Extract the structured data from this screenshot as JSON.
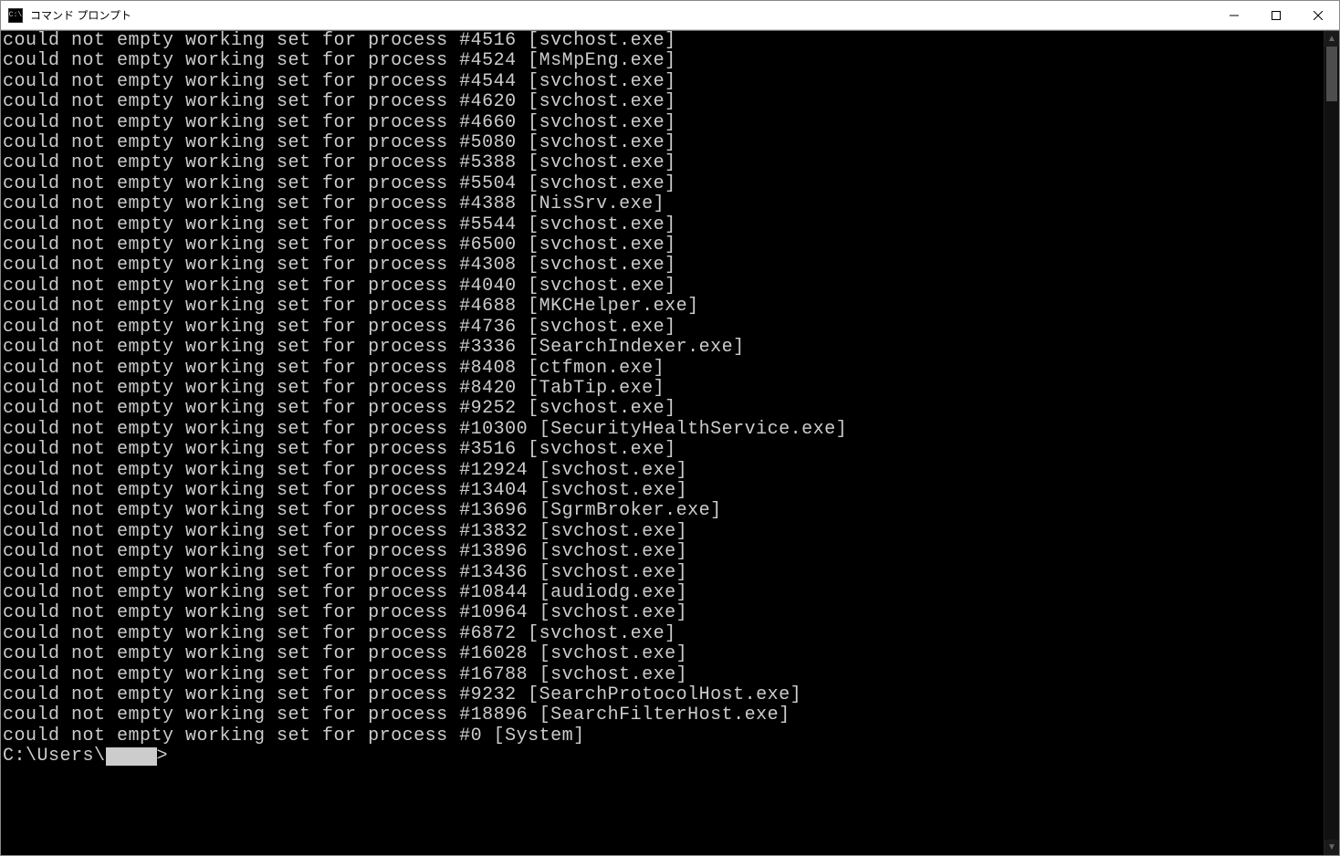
{
  "window": {
    "title": "コマンド プロンプト",
    "icon_label": "C:\\"
  },
  "terminal": {
    "message_prefix": "could not empty working set for process #",
    "lines": [
      {
        "pid": "4516",
        "proc": "svchost.exe"
      },
      {
        "pid": "4524",
        "proc": "MsMpEng.exe"
      },
      {
        "pid": "4544",
        "proc": "svchost.exe"
      },
      {
        "pid": "4620",
        "proc": "svchost.exe"
      },
      {
        "pid": "4660",
        "proc": "svchost.exe"
      },
      {
        "pid": "5080",
        "proc": "svchost.exe"
      },
      {
        "pid": "5388",
        "proc": "svchost.exe"
      },
      {
        "pid": "5504",
        "proc": "svchost.exe"
      },
      {
        "pid": "4388",
        "proc": "NisSrv.exe"
      },
      {
        "pid": "5544",
        "proc": "svchost.exe"
      },
      {
        "pid": "6500",
        "proc": "svchost.exe"
      },
      {
        "pid": "4308",
        "proc": "svchost.exe"
      },
      {
        "pid": "4040",
        "proc": "svchost.exe"
      },
      {
        "pid": "4688",
        "proc": "MKCHelper.exe"
      },
      {
        "pid": "4736",
        "proc": "svchost.exe"
      },
      {
        "pid": "3336",
        "proc": "SearchIndexer.exe"
      },
      {
        "pid": "8408",
        "proc": "ctfmon.exe"
      },
      {
        "pid": "8420",
        "proc": "TabTip.exe"
      },
      {
        "pid": "9252",
        "proc": "svchost.exe"
      },
      {
        "pid": "10300",
        "proc": "SecurityHealthService.exe"
      },
      {
        "pid": "3516",
        "proc": "svchost.exe"
      },
      {
        "pid": "12924",
        "proc": "svchost.exe"
      },
      {
        "pid": "13404",
        "proc": "svchost.exe"
      },
      {
        "pid": "13696",
        "proc": "SgrmBroker.exe"
      },
      {
        "pid": "13832",
        "proc": "svchost.exe"
      },
      {
        "pid": "13896",
        "proc": "svchost.exe"
      },
      {
        "pid": "13436",
        "proc": "svchost.exe"
      },
      {
        "pid": "10844",
        "proc": "audiodg.exe"
      },
      {
        "pid": "10964",
        "proc": "svchost.exe"
      },
      {
        "pid": "6872",
        "proc": "svchost.exe"
      },
      {
        "pid": "16028",
        "proc": "svchost.exe"
      },
      {
        "pid": "16788",
        "proc": "svchost.exe"
      },
      {
        "pid": "9232",
        "proc": "SearchProtocolHost.exe"
      },
      {
        "pid": "18896",
        "proc": "SearchFilterHost.exe"
      },
      {
        "pid": "0",
        "proc": "System"
      }
    ],
    "prompt_prefix": "C:\\Users\\",
    "prompt_suffix": ">"
  }
}
